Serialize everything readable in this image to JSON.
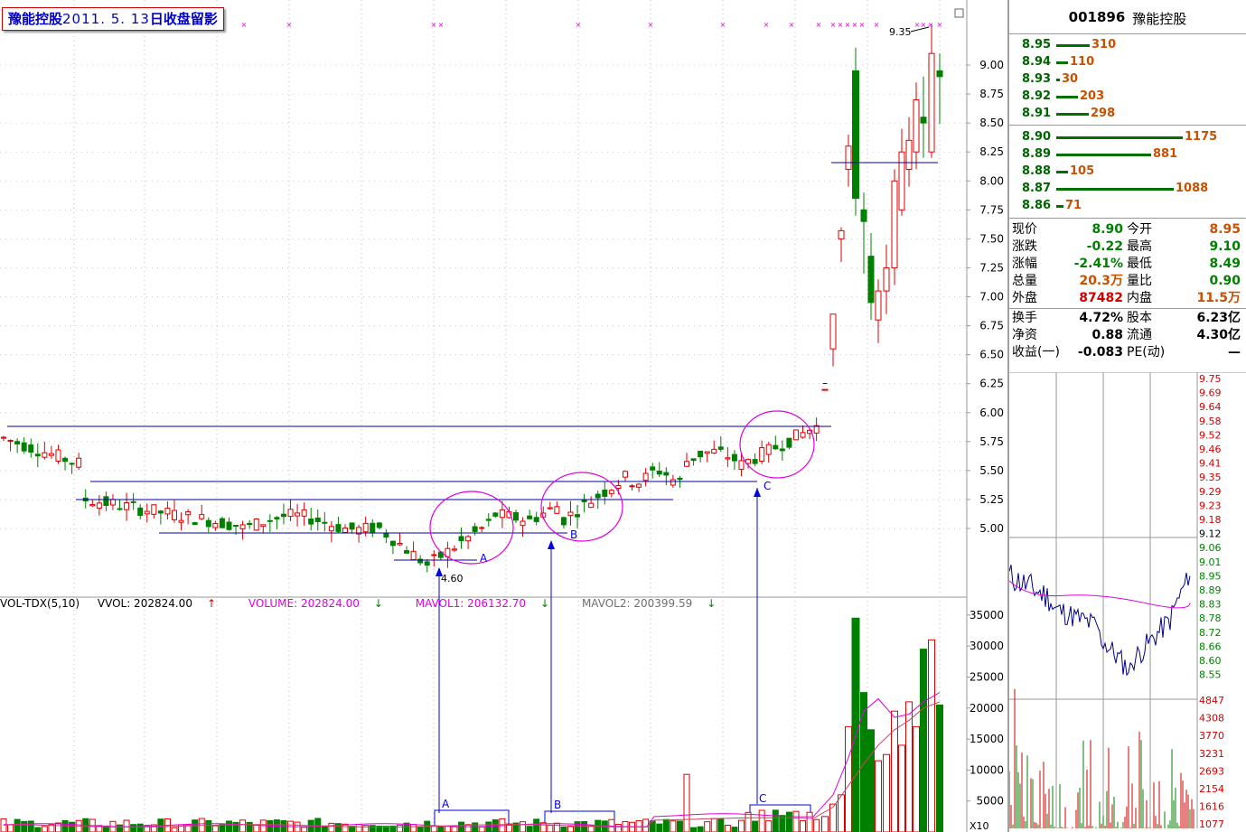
{
  "title": {
    "name": "豫能控股",
    "date": "2011. 5. 13",
    "suffix": "日收盘留影"
  },
  "colors": {
    "up": "#e00000",
    "down": "#008000",
    "annotation": "#0000e0",
    "circle": "#e000e0",
    "ma": "#e000e0"
  },
  "main_chart": {
    "price_axis": [
      "9.00",
      "8.75",
      "8.50",
      "8.25",
      "8.00",
      "7.75",
      "7.50",
      "7.25",
      "7.00",
      "6.75",
      "6.50",
      "6.25",
      "6.00",
      "5.75",
      "5.50",
      "5.25",
      "5.00"
    ],
    "annotations": {
      "high_label": "9.35",
      "low_label": "4.60",
      "marker_a": "A",
      "marker_b": "B",
      "marker_c": "C",
      "marker_a_vol": "A",
      "marker_b_vol": "B",
      "marker_c_vol": "C",
      "dash": "–"
    }
  },
  "volume_legend": {
    "name": "VOL-TDX(5,10)",
    "vvol": "VVOL: 202824.00",
    "volume": "VOLUME: 202824.00",
    "mavol1": "MAVOL1: 206132.70",
    "mavol2": "MAVOL2: 200399.59",
    "axis": [
      "35000",
      "30000",
      "25000",
      "20000",
      "15000",
      "10000",
      "5000"
    ],
    "scale_label": "X10"
  },
  "chart_data": {
    "type": "candlestick",
    "title": "豫能控股 2011. 5. 13 日收盘留影",
    "ylim": [
      4.6,
      9.35
    ],
    "phase1_close_range": [
      4.6,
      5.95
    ],
    "breakout_high": 9.35,
    "volume_ylim": [
      0,
      36000
    ]
  },
  "panel": {
    "code": "001896",
    "name": "豫能控股",
    "asks": [
      {
        "price": "8.95",
        "vol": "310"
      },
      {
        "price": "8.94",
        "vol": "110"
      },
      {
        "price": "8.93",
        "vol": "30"
      },
      {
        "price": "8.92",
        "vol": "203"
      },
      {
        "price": "8.91",
        "vol": "298"
      }
    ],
    "bids": [
      {
        "price": "8.90",
        "vol": "1175"
      },
      {
        "price": "8.89",
        "vol": "881"
      },
      {
        "price": "8.88",
        "vol": "105"
      },
      {
        "price": "8.87",
        "vol": "1088"
      },
      {
        "price": "8.86",
        "vol": "71"
      }
    ],
    "quote": [
      {
        "l1": "现价",
        "v1": "8.90",
        "l2": "今开",
        "v2": "8.95"
      },
      {
        "l1": "涨跌",
        "v1": "-0.22",
        "l2": "最高",
        "v2": "9.10"
      },
      {
        "l1": "涨幅",
        "v1": "-2.41%",
        "l2": "最低",
        "v2": "8.49"
      },
      {
        "l1": "总量",
        "v1": "20.3万",
        "l2": "量比",
        "v2": "0.90"
      },
      {
        "l1": "外盘",
        "v1": "87482",
        "l2": "内盘",
        "v2": "11.5万"
      },
      {
        "l1": "换手",
        "v1": "4.72%",
        "l2": "股本",
        "v2": "6.23亿"
      },
      {
        "l1": "净资",
        "v1": "0.88",
        "l2": "流通",
        "v2": "4.30亿"
      },
      {
        "l1": "收益(一)",
        "v1": "-0.083",
        "l2": "PE(动)",
        "v2": "—"
      }
    ],
    "minute_price_axis": [
      "9.75",
      "9.69",
      "9.64",
      "9.58",
      "9.52",
      "9.46",
      "9.41",
      "9.35",
      "9.29",
      "9.23",
      "9.18",
      "9.12",
      "9.06",
      "9.01",
      "8.95",
      "8.89",
      "8.83",
      "8.78",
      "8.72",
      "8.66",
      "8.60",
      "8.55"
    ],
    "minute_vol_axis": [
      "4847",
      "4308",
      "3770",
      "3231",
      "2693",
      "2154",
      "1616",
      "1077"
    ]
  }
}
